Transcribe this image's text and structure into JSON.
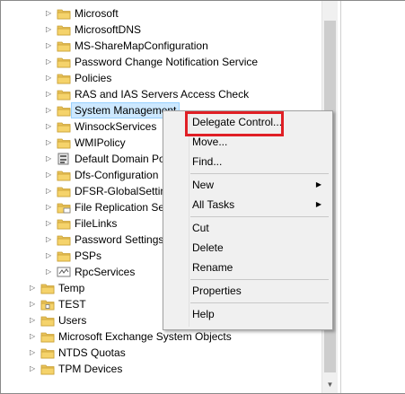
{
  "tree": {
    "items": [
      {
        "label": "Microsoft",
        "indent": 1,
        "expandable": true,
        "icon": "folder-icon"
      },
      {
        "label": "MicrosoftDNS",
        "indent": 1,
        "expandable": true,
        "icon": "folder-icon"
      },
      {
        "label": "MS-ShareMapConfiguration",
        "indent": 1,
        "expandable": true,
        "icon": "folder-icon"
      },
      {
        "label": "Password Change Notification Service",
        "indent": 1,
        "expandable": true,
        "icon": "folder-icon"
      },
      {
        "label": "Policies",
        "indent": 1,
        "expandable": true,
        "icon": "folder-icon"
      },
      {
        "label": "RAS and IAS Servers Access Check",
        "indent": 1,
        "expandable": true,
        "icon": "folder-icon"
      },
      {
        "label": "System Management",
        "indent": 1,
        "expandable": true,
        "icon": "folder-icon",
        "selected": true
      },
      {
        "label": "WinsockServices",
        "indent": 1,
        "expandable": true,
        "icon": "folder-icon"
      },
      {
        "label": "WMIPolicy",
        "indent": 1,
        "expandable": true,
        "icon": "folder-icon"
      },
      {
        "label": "Default Domain Po",
        "indent": 1,
        "expandable": true,
        "icon": "policy-object-icon"
      },
      {
        "label": "Dfs-Configuration",
        "indent": 1,
        "expandable": true,
        "icon": "folder-icon"
      },
      {
        "label": "DFSR-GlobalSettin",
        "indent": 1,
        "expandable": true,
        "icon": "folder-icon"
      },
      {
        "label": "File Replication Ser",
        "indent": 1,
        "expandable": true,
        "icon": "replication-folder-icon"
      },
      {
        "label": "FileLinks",
        "indent": 1,
        "expandable": true,
        "icon": "folder-icon"
      },
      {
        "label": "Password Settings",
        "indent": 1,
        "expandable": true,
        "icon": "folder-icon"
      },
      {
        "label": "PSPs",
        "indent": 1,
        "expandable": true,
        "icon": "folder-icon"
      },
      {
        "label": "RpcServices",
        "indent": 1,
        "expandable": true,
        "icon": "rpc-container-icon"
      },
      {
        "label": "Temp",
        "indent": 0,
        "expandable": true,
        "icon": "folder-icon"
      },
      {
        "label": "TEST",
        "indent": 0,
        "expandable": true,
        "icon": "ou-icon"
      },
      {
        "label": "Users",
        "indent": 0,
        "expandable": true,
        "icon": "folder-icon"
      },
      {
        "label": "Microsoft Exchange System Objects",
        "indent": 0,
        "expandable": true,
        "icon": "folder-icon"
      },
      {
        "label": "NTDS Quotas",
        "indent": 0,
        "expandable": true,
        "icon": "folder-icon"
      },
      {
        "label": "TPM Devices",
        "indent": 0,
        "expandable": true,
        "icon": "folder-icon"
      }
    ]
  },
  "context_menu": {
    "items": [
      {
        "label": "Delegate Control...",
        "name": "menu-item-delegate-control",
        "submenu": false
      },
      {
        "label": "Move...",
        "name": "menu-item-move",
        "submenu": false
      },
      {
        "label": "Find...",
        "name": "menu-item-find",
        "submenu": false
      },
      {
        "label": "New",
        "name": "menu-item-new",
        "submenu": true
      },
      {
        "label": "All Tasks",
        "name": "menu-item-all-tasks",
        "submenu": true
      },
      {
        "label": "Cut",
        "name": "menu-item-cut",
        "submenu": false
      },
      {
        "label": "Delete",
        "name": "menu-item-delete",
        "submenu": false
      },
      {
        "label": "Rename",
        "name": "menu-item-rename",
        "submenu": false
      },
      {
        "label": "Properties",
        "name": "menu-item-properties",
        "submenu": false
      },
      {
        "label": "Help",
        "name": "menu-item-help",
        "submenu": false
      }
    ],
    "separators_after": [
      2,
      4,
      7,
      8
    ]
  },
  "colors": {
    "highlight_border": "#e01f25",
    "selection_bg": "#cde8ff",
    "folder_yellow": "#f5d36b"
  }
}
